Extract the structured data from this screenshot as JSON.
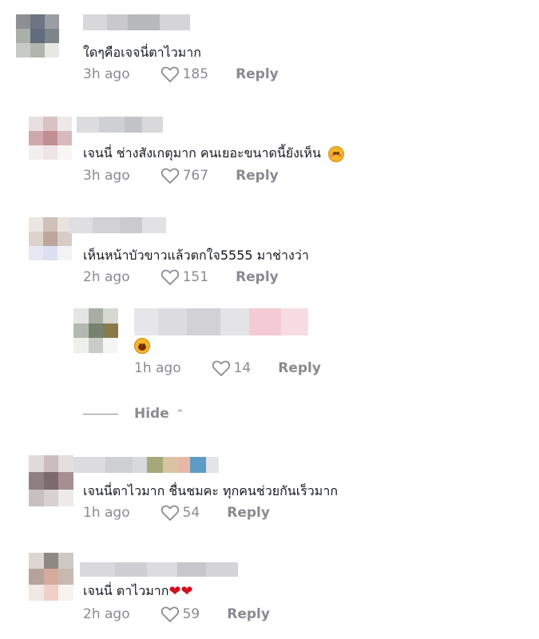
{
  "comments": [
    {
      "text": "ใดๆคือเจจนี่ตาไวมาก",
      "time": "3h ago",
      "likes": "185",
      "reply": "Reply"
    },
    {
      "text": "เจนนี่ ช่างสังเกตุมาก คนเยอะขนาดนี้ยังเห็น",
      "time": "3h ago",
      "likes": "767",
      "reply": "Reply"
    },
    {
      "text": "เห็นหน้าบัวขาวแล้วตกใจ5555 มาช่างว่า",
      "time": "2h ago",
      "likes": "151",
      "reply": "Reply"
    },
    {
      "text": "",
      "time": "1h ago",
      "likes": "14",
      "reply": "Reply"
    },
    {
      "text": "เจนนี่ตาไวมาก ชื่นชมคะ ทุกคนช่วยกันเร็วมาก",
      "time": "1h ago",
      "likes": "54",
      "reply": "Reply"
    },
    {
      "text": "เจนนี่ ตาไวมาก",
      "time": "2h ago",
      "likes": "59",
      "reply": "Reply"
    }
  ],
  "hide": {
    "label": "Hide"
  },
  "icons": {
    "like": "heart-outline-icon",
    "collapse": "chevron-up-icon",
    "emoji_face": "smiling-face-emoji",
    "emoji_heart": "red-heart-emoji"
  },
  "colors": {
    "meta": "#8a8b91",
    "text": "#161823",
    "heart": "#d1101c"
  }
}
